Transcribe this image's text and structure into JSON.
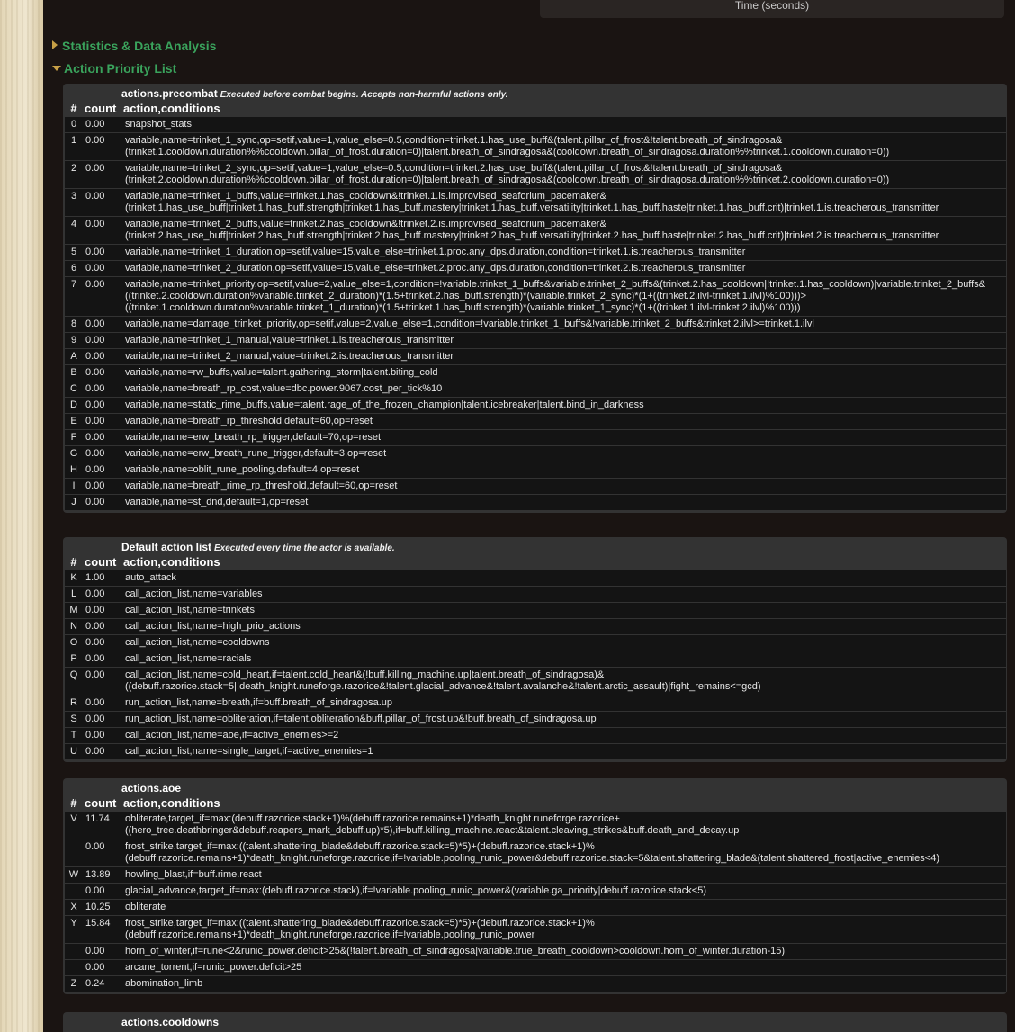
{
  "header": {
    "time_axis_label": "Time (seconds)"
  },
  "sections": {
    "statistics": "Statistics & Data Analysis",
    "apl": "Action Priority List"
  },
  "columns": {
    "id": "#",
    "count": "count",
    "action": "action,conditions"
  },
  "precombat": {
    "title": "actions.precombat",
    "description": "Executed before combat begins. Accepts non-harmful actions only.",
    "rows": [
      {
        "id": "0",
        "count": "0.00",
        "action": "snapshot_stats"
      },
      {
        "id": "1",
        "count": "0.00",
        "action": "variable,name=trinket_1_sync,op=setif,value=1,value_else=0.5,condition=trinket.1.has_use_buff&(talent.pillar_of_frost&!talent.breath_of_sindragosa&(trinket.1.cooldown.duration%%cooldown.pillar_of_frost.duration=0)|talent.breath_of_sindragosa&(cooldown.breath_of_sindragosa.duration%%trinket.1.cooldown.duration=0))"
      },
      {
        "id": "2",
        "count": "0.00",
        "action": "variable,name=trinket_2_sync,op=setif,value=1,value_else=0.5,condition=trinket.2.has_use_buff&(talent.pillar_of_frost&!talent.breath_of_sindragosa&(trinket.2.cooldown.duration%%cooldown.pillar_of_frost.duration=0)|talent.breath_of_sindragosa&(cooldown.breath_of_sindragosa.duration%%trinket.2.cooldown.duration=0))"
      },
      {
        "id": "3",
        "count": "0.00",
        "action": "variable,name=trinket_1_buffs,value=trinket.1.has_cooldown&!trinket.1.is.improvised_seaforium_pacemaker&(trinket.1.has_use_buff|trinket.1.has_buff.strength|trinket.1.has_buff.mastery|trinket.1.has_buff.versatility|trinket.1.has_buff.haste|trinket.1.has_buff.crit)|trinket.1.is.treacherous_transmitter"
      },
      {
        "id": "4",
        "count": "0.00",
        "action": "variable,name=trinket_2_buffs,value=trinket.2.has_cooldown&!trinket.2.is.improvised_seaforium_pacemaker&(trinket.2.has_use_buff|trinket.2.has_buff.strength|trinket.2.has_buff.mastery|trinket.2.has_buff.versatility|trinket.2.has_buff.haste|trinket.2.has_buff.crit)|trinket.2.is.treacherous_transmitter"
      },
      {
        "id": "5",
        "count": "0.00",
        "action": "variable,name=trinket_1_duration,op=setif,value=15,value_else=trinket.1.proc.any_dps.duration,condition=trinket.1.is.treacherous_transmitter"
      },
      {
        "id": "6",
        "count": "0.00",
        "action": "variable,name=trinket_2_duration,op=setif,value=15,value_else=trinket.2.proc.any_dps.duration,condition=trinket.2.is.treacherous_transmitter"
      },
      {
        "id": "7",
        "count": "0.00",
        "action": "variable,name=trinket_priority,op=setif,value=2,value_else=1,condition=!variable.trinket_1_buffs&variable.trinket_2_buffs&(trinket.2.has_cooldown|!trinket.1.has_cooldown)|variable.trinket_2_buffs&((trinket.2.cooldown.duration%variable.trinket_2_duration)*(1.5+trinket.2.has_buff.strength)*(variable.trinket_2_sync)*(1+((trinket.2.ilvl-trinket.1.ilvl)%100)))>((trinket.1.cooldown.duration%variable.trinket_1_duration)*(1.5+trinket.1.has_buff.strength)*(variable.trinket_1_sync)*(1+((trinket.1.ilvl-trinket.2.ilvl)%100)))"
      },
      {
        "id": "8",
        "count": "0.00",
        "action": "variable,name=damage_trinket_priority,op=setif,value=2,value_else=1,condition=!variable.trinket_1_buffs&!variable.trinket_2_buffs&trinket.2.ilvl>=trinket.1.ilvl"
      },
      {
        "id": "9",
        "count": "0.00",
        "action": "variable,name=trinket_1_manual,value=trinket.1.is.treacherous_transmitter"
      },
      {
        "id": "A",
        "count": "0.00",
        "action": "variable,name=trinket_2_manual,value=trinket.2.is.treacherous_transmitter"
      },
      {
        "id": "B",
        "count": "0.00",
        "action": "variable,name=rw_buffs,value=talent.gathering_storm|talent.biting_cold"
      },
      {
        "id": "C",
        "count": "0.00",
        "action": "variable,name=breath_rp_cost,value=dbc.power.9067.cost_per_tick%10"
      },
      {
        "id": "D",
        "count": "0.00",
        "action": "variable,name=static_rime_buffs,value=talent.rage_of_the_frozen_champion|talent.icebreaker|talent.bind_in_darkness"
      },
      {
        "id": "E",
        "count": "0.00",
        "action": "variable,name=breath_rp_threshold,default=60,op=reset"
      },
      {
        "id": "F",
        "count": "0.00",
        "action": "variable,name=erw_breath_rp_trigger,default=70,op=reset"
      },
      {
        "id": "G",
        "count": "0.00",
        "action": "variable,name=erw_breath_rune_trigger,default=3,op=reset"
      },
      {
        "id": "H",
        "count": "0.00",
        "action": "variable,name=oblit_rune_pooling,default=4,op=reset"
      },
      {
        "id": "I",
        "count": "0.00",
        "action": "variable,name=breath_rime_rp_threshold,default=60,op=reset"
      },
      {
        "id": "J",
        "count": "0.00",
        "action": "variable,name=st_dnd,default=1,op=reset"
      }
    ]
  },
  "default": {
    "title": "Default action list",
    "description": "Executed every time the actor is available.",
    "rows": [
      {
        "id": "K",
        "count": "1.00",
        "action": "auto_attack"
      },
      {
        "id": "L",
        "count": "0.00",
        "action": "call_action_list,name=variables"
      },
      {
        "id": "M",
        "count": "0.00",
        "action": "call_action_list,name=trinkets"
      },
      {
        "id": "N",
        "count": "0.00",
        "action": "call_action_list,name=high_prio_actions"
      },
      {
        "id": "O",
        "count": "0.00",
        "action": "call_action_list,name=cooldowns"
      },
      {
        "id": "P",
        "count": "0.00",
        "action": "call_action_list,name=racials"
      },
      {
        "id": "Q",
        "count": "0.00",
        "action": "call_action_list,name=cold_heart,if=talent.cold_heart&(!buff.killing_machine.up|talent.breath_of_sindragosa)&((debuff.razorice.stack=5|!death_knight.runeforge.razorice&!talent.glacial_advance&!talent.avalanche&!talent.arctic_assault)|fight_remains<=gcd)"
      },
      {
        "id": "R",
        "count": "0.00",
        "action": "run_action_list,name=breath,if=buff.breath_of_sindragosa.up"
      },
      {
        "id": "S",
        "count": "0.00",
        "action": "run_action_list,name=obliteration,if=talent.obliteration&buff.pillar_of_frost.up&!buff.breath_of_sindragosa.up"
      },
      {
        "id": "T",
        "count": "0.00",
        "action": "call_action_list,name=aoe,if=active_enemies>=2"
      },
      {
        "id": "U",
        "count": "0.00",
        "action": "call_action_list,name=single_target,if=active_enemies=1"
      }
    ]
  },
  "aoe": {
    "title": "actions.aoe",
    "description": "",
    "rows": [
      {
        "id": "V",
        "count": "11.74",
        "action": "obliterate,target_if=max:(debuff.razorice.stack+1)%(debuff.razorice.remains+1)*death_knight.runeforge.razorice+((hero_tree.deathbringer&debuff.reapers_mark_debuff.up)*5),if=buff.killing_machine.react&talent.cleaving_strikes&buff.death_and_decay.up"
      },
      {
        "id": "",
        "count": "0.00",
        "action": "frost_strike,target_if=max:((talent.shattering_blade&debuff.razorice.stack=5)*5)+(debuff.razorice.stack+1)%(debuff.razorice.remains+1)*death_knight.runeforge.razorice,if=!variable.pooling_runic_power&debuff.razorice.stack=5&talent.shattering_blade&(talent.shattered_frost|active_enemies<4)"
      },
      {
        "id": "W",
        "count": "13.89",
        "action": "howling_blast,if=buff.rime.react"
      },
      {
        "id": "",
        "count": "0.00",
        "action": "glacial_advance,target_if=max:(debuff.razorice.stack),if=!variable.pooling_runic_power&(variable.ga_priority|debuff.razorice.stack<5)"
      },
      {
        "id": "X",
        "count": "10.25",
        "action": "obliterate"
      },
      {
        "id": "Y",
        "count": "15.84",
        "action": "frost_strike,target_if=max:((talent.shattering_blade&debuff.razorice.stack=5)*5)+(debuff.razorice.stack+1)%(debuff.razorice.remains+1)*death_knight.runeforge.razorice,if=!variable.pooling_runic_power"
      },
      {
        "id": "",
        "count": "0.00",
        "action": "horn_of_winter,if=rune<2&runic_power.deficit>25&(!talent.breath_of_sindragosa|variable.true_breath_cooldown>cooldown.horn_of_winter.duration-15)"
      },
      {
        "id": "",
        "count": "0.00",
        "action": "arcane_torrent,if=runic_power.deficit>25"
      },
      {
        "id": "Z",
        "count": "0.24",
        "action": "abomination_limb"
      }
    ]
  },
  "cooldowns": {
    "title": "actions.cooldowns"
  }
}
